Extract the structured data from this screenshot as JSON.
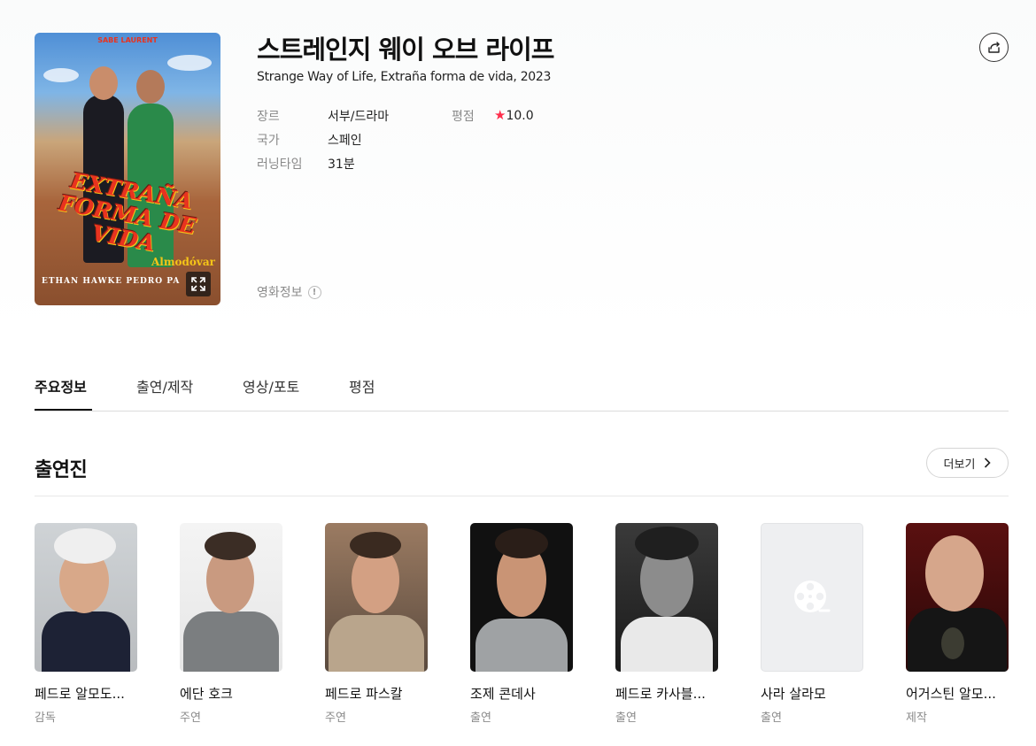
{
  "movie": {
    "title": "스트레인지 웨이 오브 라이프",
    "subtitle": "Strange Way of Life, Extraña forma de vida, 2023",
    "poster": {
      "top_text": "SABE LAURENT",
      "title_text": "EXTRAÑA FORMA DE VIDA",
      "director_text": "Almodóvar",
      "cast_text": "ETHAN HAWKE   PEDRO PA"
    },
    "meta": {
      "genre_label": "장르",
      "genre": "서부/드라마",
      "rating_label": "평점",
      "rating": "10.0",
      "country_label": "국가",
      "country": "스페인",
      "runtime_label": "러닝타임",
      "runtime": "31분"
    },
    "info_link": "영화정보",
    "info_icon_glyph": "!"
  },
  "tabs": [
    {
      "label": "주요정보",
      "active": true
    },
    {
      "label": "출연/제작",
      "active": false
    },
    {
      "label": "영상/포토",
      "active": false
    },
    {
      "label": "평점",
      "active": false
    }
  ],
  "cast_section": {
    "title": "출연진",
    "more_label": "더보기",
    "members": [
      {
        "name": "페드로 알모도...",
        "role": "감독"
      },
      {
        "name": "에단 호크",
        "role": "주연"
      },
      {
        "name": "페드로 파스칼",
        "role": "주연"
      },
      {
        "name": "조제 콘데사",
        "role": "출연"
      },
      {
        "name": "페드로 카사블...",
        "role": "출연"
      },
      {
        "name": "사라 살라모",
        "role": "출연"
      },
      {
        "name": "어거스틴 알모...",
        "role": "제작"
      }
    ]
  },
  "colors": {
    "rating_star": "#ff2d4b",
    "muted_text": "#8a8a8a",
    "placeholder_bg": "#eeeff1"
  }
}
